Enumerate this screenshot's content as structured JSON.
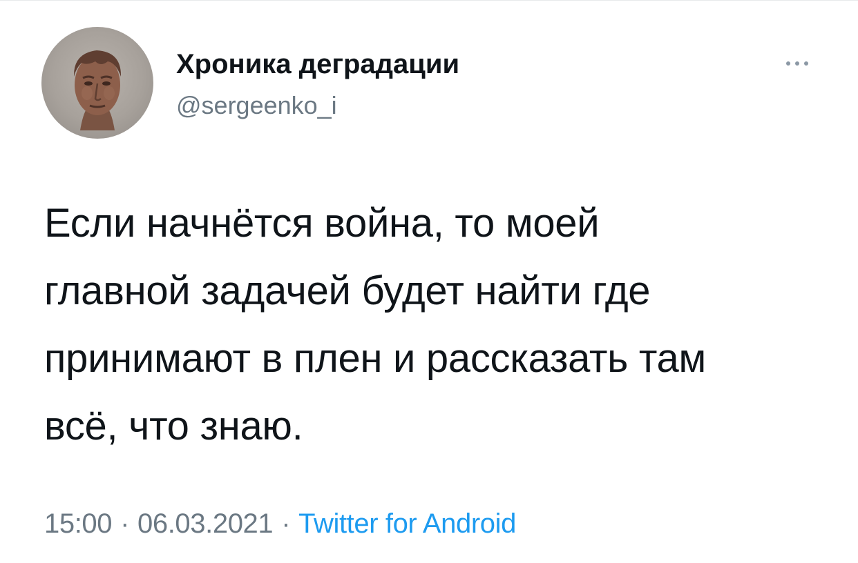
{
  "tweet": {
    "author": {
      "display_name": "Хроника деградации",
      "handle": "@sergeenko_i",
      "avatar_icon": "roman-bust-avatar"
    },
    "more_icon": "more-horizontal-icon",
    "text": "Если начнётся война, то моей\nглавной задачей будет найти где\nпринимают в плен и рассказать там\nвсё, что знаю.",
    "time": "15:00",
    "date": "06.03.2021",
    "separator": "·",
    "source": "Twitter for Android",
    "colors": {
      "text": "#0f1419",
      "secondary": "#6b7883",
      "link": "#1d9bf0"
    }
  }
}
